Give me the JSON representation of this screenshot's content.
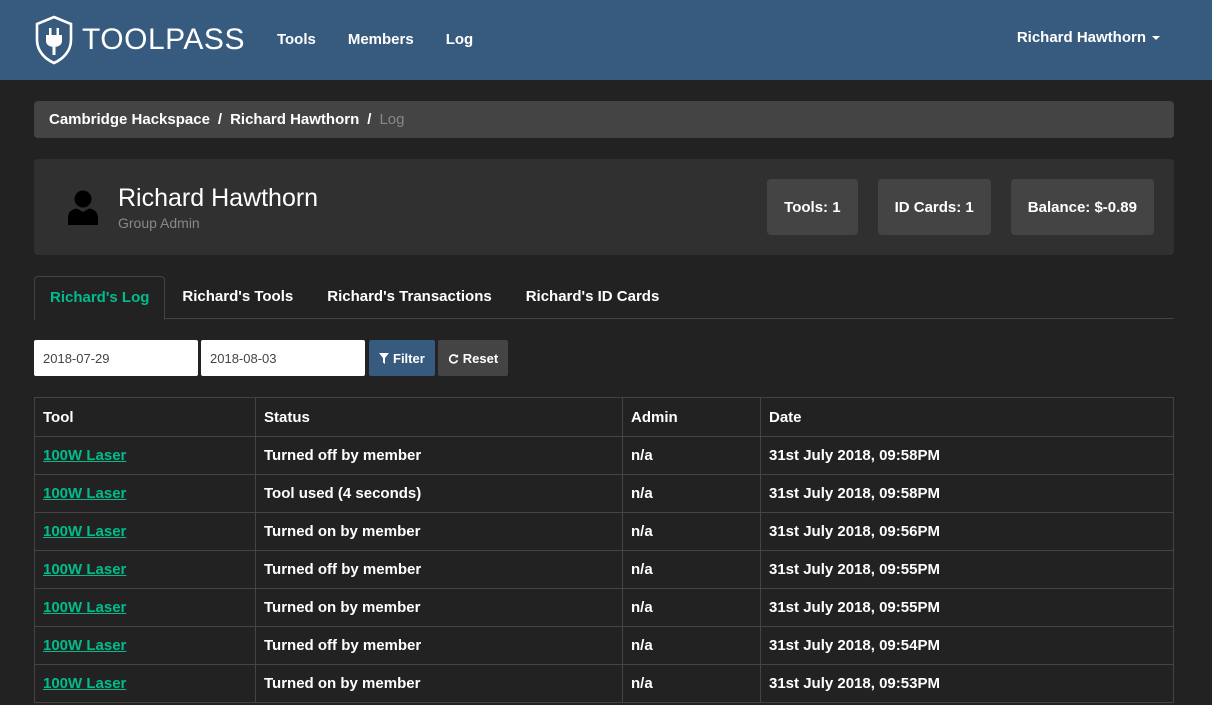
{
  "nav": {
    "brand": "TOOLPASS",
    "links": [
      "Tools",
      "Members",
      "Log"
    ],
    "user": "Richard Hawthorn"
  },
  "breadcrumb": {
    "items": [
      "Cambridge Hackspace",
      "Richard Hawthorn"
    ],
    "active": "Log",
    "separator": "/"
  },
  "profile": {
    "name": "Richard Hawthorn",
    "role": "Group Admin",
    "stats": [
      "Tools: 1",
      "ID Cards: 1",
      "Balance: $-0.89"
    ]
  },
  "tabs": [
    "Richard's Log",
    "Richard's Tools",
    "Richard's Transactions",
    "Richard's ID Cards"
  ],
  "filters": {
    "from": "2018-07-29",
    "to": "2018-08-03",
    "filter_label": "Filter",
    "reset_label": "Reset"
  },
  "table": {
    "headers": [
      "Tool",
      "Status",
      "Admin",
      "Date"
    ],
    "rows": [
      [
        "100W Laser",
        "Turned off by member",
        "n/a",
        "31st July 2018, 09:58PM"
      ],
      [
        "100W Laser",
        "Tool used (4 seconds)",
        "n/a",
        "31st July 2018, 09:58PM"
      ],
      [
        "100W Laser",
        "Turned on by member",
        "n/a",
        "31st July 2018, 09:56PM"
      ],
      [
        "100W Laser",
        "Turned off by member",
        "n/a",
        "31st July 2018, 09:55PM"
      ],
      [
        "100W Laser",
        "Turned on by member",
        "n/a",
        "31st July 2018, 09:55PM"
      ],
      [
        "100W Laser",
        "Turned off by member",
        "n/a",
        "31st July 2018, 09:54PM"
      ],
      [
        "100W Laser",
        "Turned on by member",
        "n/a",
        "31st July 2018, 09:53PM"
      ]
    ]
  },
  "colors": {
    "navbar": "#375a7f",
    "background": "#222222",
    "accent": "#00bc8c",
    "panel": "#303030",
    "well": "#444444"
  },
  "icons": {
    "brand": "shield-plug-icon",
    "avatar": "user-icon",
    "filter": "filter-icon",
    "reset": "refresh-icon"
  }
}
